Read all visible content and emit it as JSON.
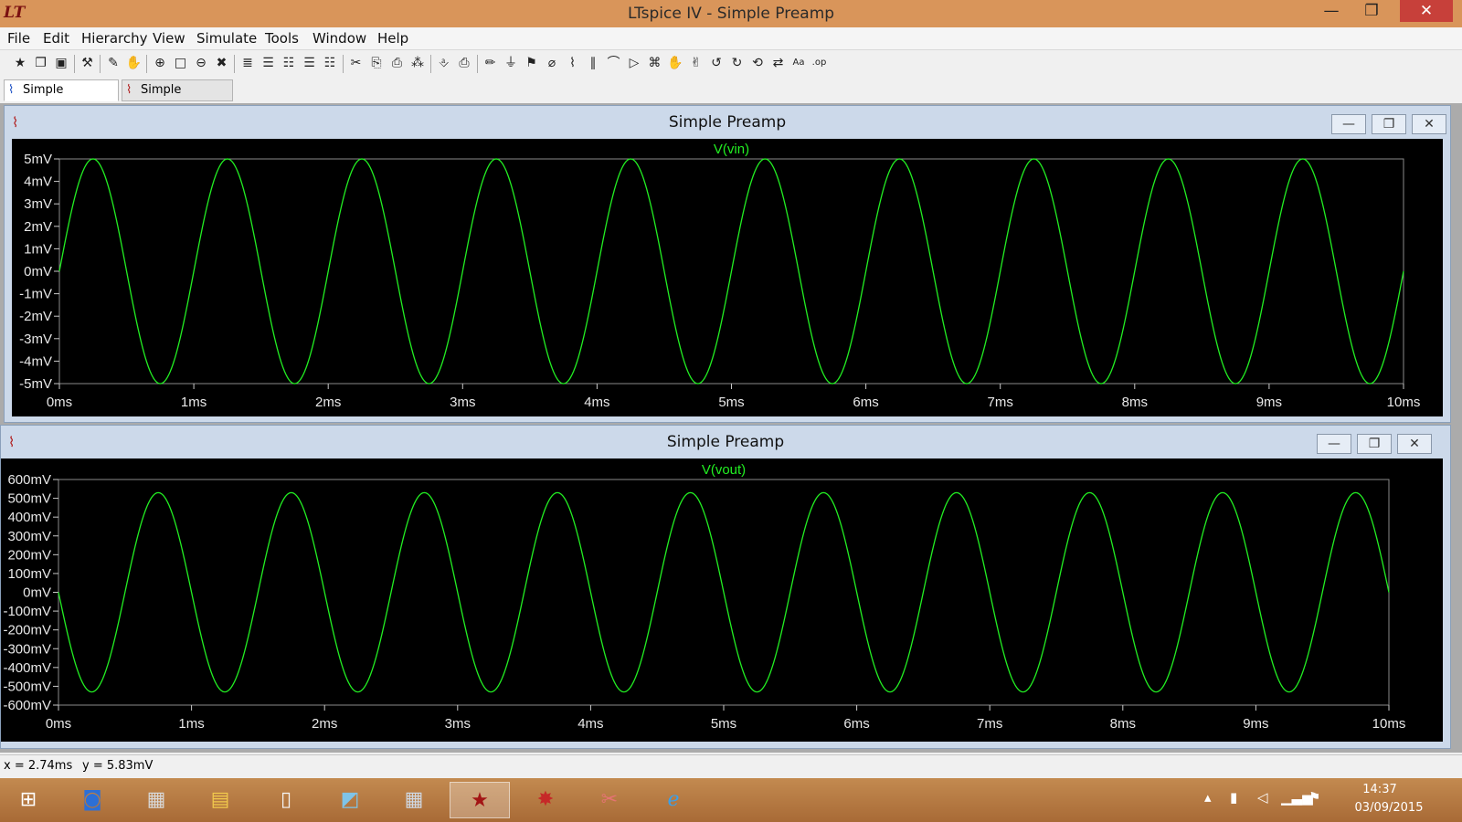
{
  "window": {
    "title": "LTspice IV - Simple Preamp",
    "minimize_label": "—",
    "restore_label": "❐",
    "close_label": "✕"
  },
  "menu": [
    "File",
    "Edit",
    "Hierarchy",
    "View",
    "Simulate",
    "Tools",
    "Window",
    "Help"
  ],
  "toolbar": {
    "icons": [
      "new-schematic",
      "open",
      "save",
      "control-panel",
      "run",
      "halt",
      "zoom-in",
      "zoom-area",
      "zoom-out",
      "zoom-fit",
      "autorange",
      "cascade",
      "tile-horizontal",
      "tile-vertical",
      "tile-all",
      "cut",
      "copy",
      "paste",
      "find",
      "print-preview",
      "print",
      "draw-wire",
      "ground",
      "label-net",
      "component",
      "resistor",
      "capacitor",
      "inductor",
      "diode",
      "spice-directive",
      "move",
      "drag",
      "undo",
      "redo",
      "rotate",
      "mirror",
      "text",
      "spice-op"
    ],
    "glyphs": [
      "★",
      "❐",
      "▣",
      "⚒",
      "✎",
      "✋",
      "⊕",
      "□",
      "⊖",
      "✖",
      "≣",
      "☰",
      "☷",
      "☰",
      "☷",
      "✂",
      "⎘",
      "⎙",
      "⁂",
      "⎀",
      "⎙",
      "✏",
      "⏚",
      "⚑",
      "⌀",
      "⌇",
      "∥",
      "⌒",
      "▷",
      "⌘",
      "✋",
      "✌",
      "↺",
      "↻",
      "⟲",
      "⇄",
      "Aa",
      ".op"
    ]
  },
  "tabs": [
    {
      "label": "Simple Preamp",
      "icon": "schematic-icon"
    },
    {
      "label": "Simple Preamp",
      "icon": "waveform-icon"
    }
  ],
  "panes": [
    {
      "title": "Simple Preamp",
      "minimize_label": "—",
      "maximize_label": "❐",
      "close_label": "✕",
      "chart_data": {
        "type": "line",
        "series": [
          {
            "name": "V(vin)",
            "color": "#22ee22",
            "frequency_khz": 1.0,
            "amplitude": 5,
            "phase": "sine",
            "y0": 0
          }
        ],
        "x": {
          "min": 0,
          "max": 10,
          "unit": "ms",
          "ticks": [
            "0ms",
            "1ms",
            "2ms",
            "3ms",
            "4ms",
            "5ms",
            "6ms",
            "7ms",
            "8ms",
            "9ms",
            "10ms"
          ]
        },
        "y": {
          "min": -5,
          "max": 5,
          "unit": "mV",
          "ticks": [
            "5mV",
            "4mV",
            "3mV",
            "2mV",
            "1mV",
            "0mV",
            "-1mV",
            "-2mV",
            "-3mV",
            "-4mV",
            "-5mV"
          ]
        },
        "grid": false,
        "legend": "top-center"
      }
    },
    {
      "title": "Simple Preamp",
      "minimize_label": "—",
      "maximize_label": "❐",
      "close_label": "✕",
      "chart_data": {
        "type": "line",
        "series": [
          {
            "name": "V(vout)",
            "color": "#22ee22",
            "frequency_khz": 1.0,
            "amplitude": 530,
            "phase": "inverted-sine",
            "y0": 0
          }
        ],
        "x": {
          "min": 0,
          "max": 10,
          "unit": "ms",
          "ticks": [
            "0ms",
            "1ms",
            "2ms",
            "3ms",
            "4ms",
            "5ms",
            "6ms",
            "7ms",
            "8ms",
            "9ms",
            "10ms"
          ]
        },
        "y": {
          "min": -600,
          "max": 600,
          "unit": "mV",
          "ticks": [
            "600mV",
            "500mV",
            "400mV",
            "300mV",
            "200mV",
            "100mV",
            "0mV",
            "-100mV",
            "-200mV",
            "-300mV",
            "-400mV",
            "-500mV",
            "-600mV"
          ]
        },
        "grid": false,
        "legend": "top-center"
      }
    }
  ],
  "status": {
    "x_readout": "x = 2.74ms",
    "y_readout": "y = 5.83mV"
  },
  "taskbar": {
    "apps": [
      "start",
      "remote-desktop",
      "firewall",
      "file-explorer",
      "notepad",
      "paint",
      "calculator",
      "ltspice",
      "splat",
      "snipping-tool",
      "internet-explorer"
    ],
    "glyphs": [
      "⊞",
      "◙",
      "▦",
      "▤",
      "▯",
      "◩",
      "▦",
      "★",
      "✸",
      "✂",
      "ℯ"
    ],
    "tray": [
      "▴",
      "▮",
      "◁",
      "▁▃▅",
      "⚑"
    ],
    "time": "14:37",
    "date": "03/09/2015"
  }
}
